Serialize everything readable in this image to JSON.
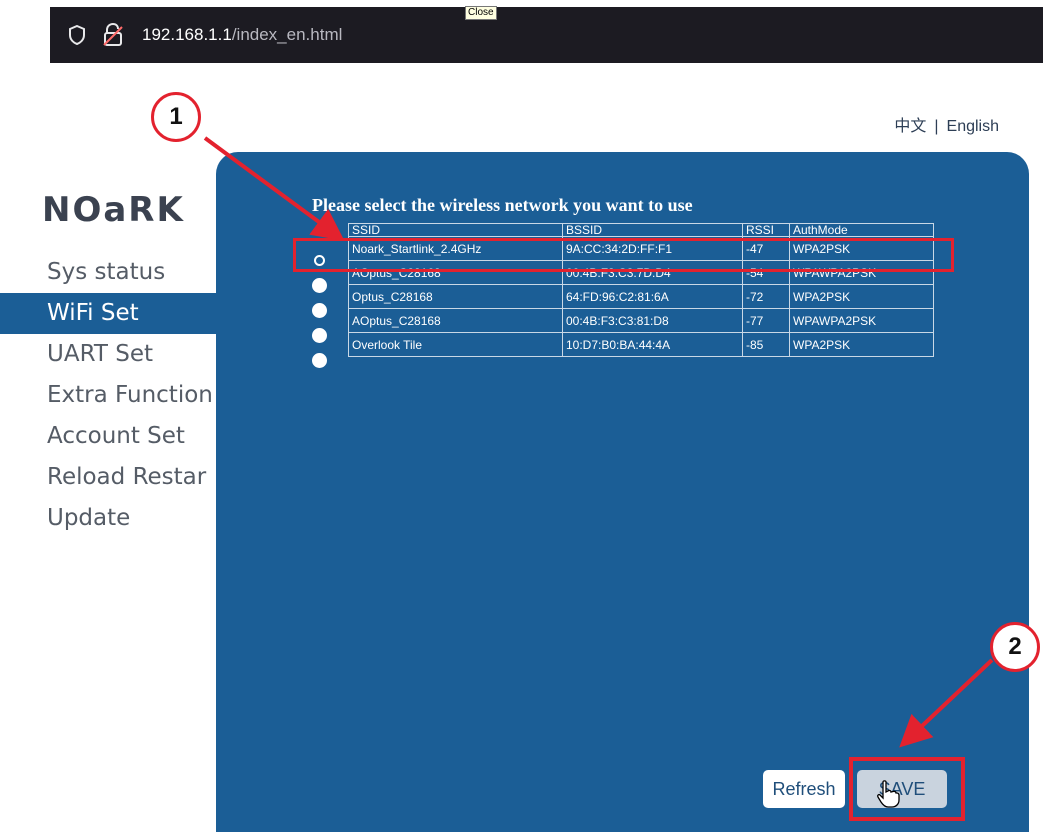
{
  "browser": {
    "url_host": "192.168.1.1",
    "url_path": "/index_en.html",
    "tooltip": "Close"
  },
  "lang": {
    "zh": "中文",
    "sep": "|",
    "en": "English"
  },
  "logo": "NOaRK",
  "nav": [
    {
      "label": "Sys status"
    },
    {
      "label": "WiFi Set"
    },
    {
      "label": "UART Set"
    },
    {
      "label": "Extra Function"
    },
    {
      "label": "Account Set"
    },
    {
      "label": "Reload Restar"
    },
    {
      "label": "Update"
    }
  ],
  "panel": {
    "title": "Please select the wireless network you want to use",
    "columns": {
      "ssid": "SSID",
      "bssid": "BSSID",
      "rssi": "RSSI",
      "auth": "AuthMode"
    },
    "rows": [
      {
        "ssid": "Noark_Startlink_2.4GHz",
        "bssid": "9A:CC:34:2D:FF:F1",
        "rssi": "-47",
        "auth": "WPA2PSK",
        "selected": true
      },
      {
        "ssid": "AOptus_C28168",
        "bssid": "00:4B:F3:C3:7D:D4",
        "rssi": "-54",
        "auth": "WPAWPA2PSK",
        "selected": false
      },
      {
        "ssid": "Optus_C28168",
        "bssid": "64:FD:96:C2:81:6A",
        "rssi": "-72",
        "auth": "WPA2PSK",
        "selected": false
      },
      {
        "ssid": "AOptus_C28168",
        "bssid": "00:4B:F3:C3:81:D8",
        "rssi": "-77",
        "auth": "WPAWPA2PSK",
        "selected": false
      },
      {
        "ssid": "Overlook Tile",
        "bssid": "10:D7:B0:BA:44:4A",
        "rssi": "-85",
        "auth": "WPA2PSK",
        "selected": false
      }
    ],
    "refresh_label": "Refresh",
    "save_label": "SAVE"
  },
  "annotations": {
    "badge1": "1",
    "badge2": "2",
    "color": "#e3222e"
  },
  "colors": {
    "panel": "#1b5e96",
    "nav_active": "#1b5e96",
    "browser_bar": "#1c1b22"
  }
}
